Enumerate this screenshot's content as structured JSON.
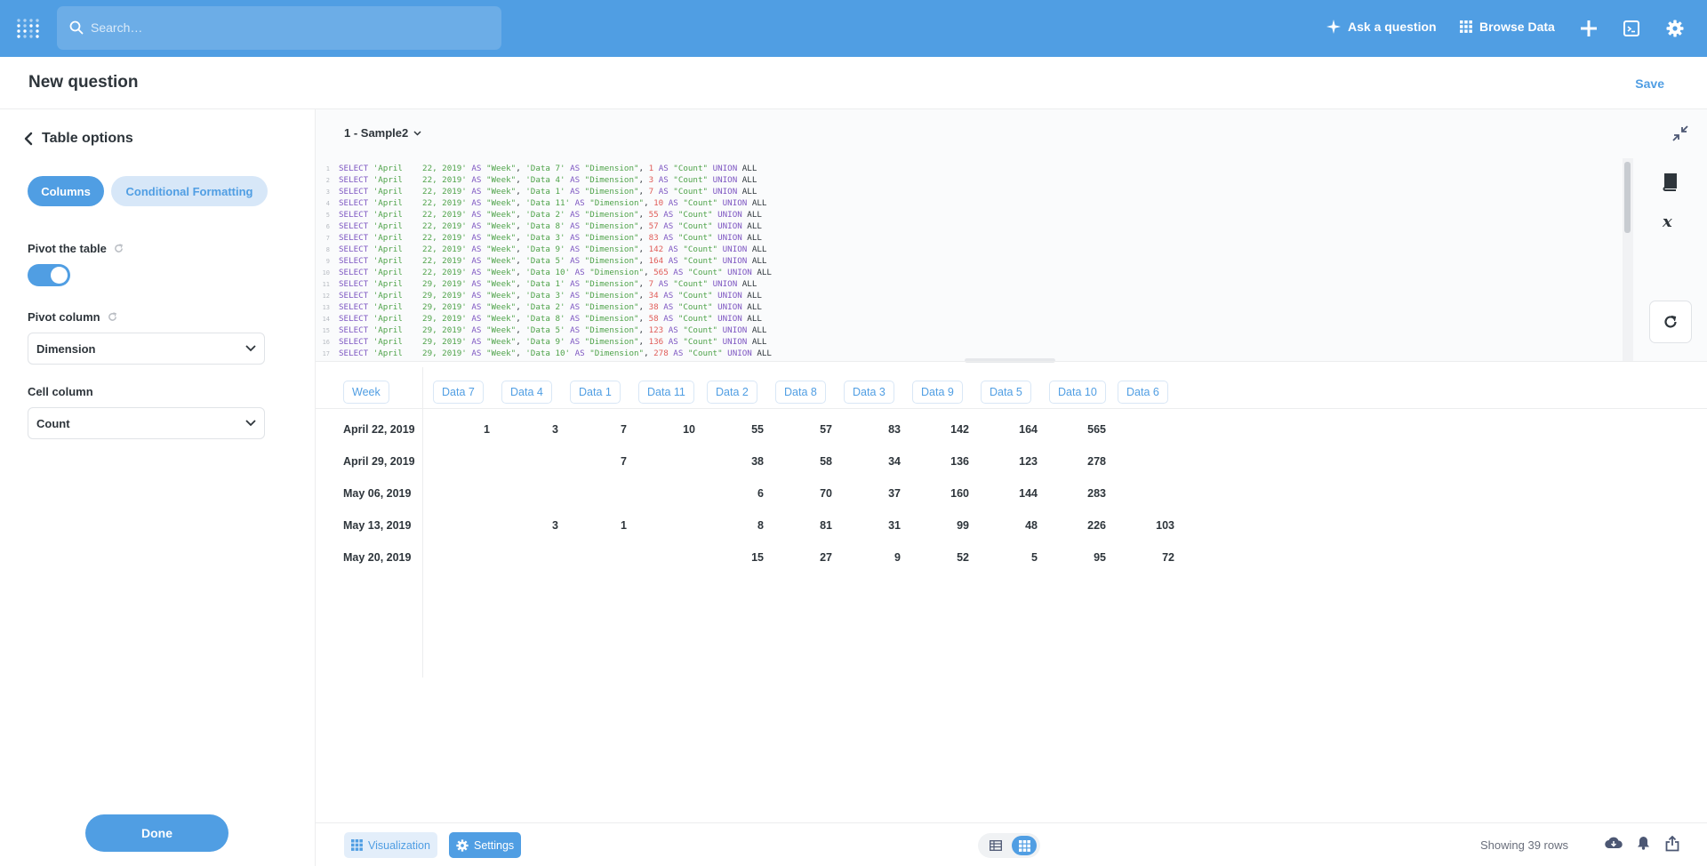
{
  "nav": {
    "search_placeholder": "Search…",
    "ask_question": "Ask a question",
    "browse_data": "Browse Data"
  },
  "header": {
    "title": "New question",
    "save": "Save"
  },
  "sidebar": {
    "back_label": "Table options",
    "tabs": {
      "columns": "Columns",
      "conditional": "Conditional Formatting"
    },
    "pivot_label": "Pivot the table",
    "pivot_on": true,
    "pivot_column_label": "Pivot column",
    "pivot_column_value": "Dimension",
    "cell_column_label": "Cell column",
    "cell_column_value": "Count",
    "done": "Done"
  },
  "editor": {
    "database": "1 - Sample2",
    "lines": [
      {
        "n": "1",
        "date": "'April    22, 2019'",
        "dim": "'Data 7'",
        "count": "1"
      },
      {
        "n": "2",
        "date": "'April    22, 2019'",
        "dim": "'Data 4'",
        "count": "3"
      },
      {
        "n": "3",
        "date": "'April    22, 2019'",
        "dim": "'Data 1'",
        "count": "7"
      },
      {
        "n": "4",
        "date": "'April    22, 2019'",
        "dim": "'Data 11'",
        "count": "10"
      },
      {
        "n": "5",
        "date": "'April    22, 2019'",
        "dim": "'Data 2'",
        "count": "55"
      },
      {
        "n": "6",
        "date": "'April    22, 2019'",
        "dim": "'Data 8'",
        "count": "57"
      },
      {
        "n": "7",
        "date": "'April    22, 2019'",
        "dim": "'Data 3'",
        "count": "83"
      },
      {
        "n": "8",
        "date": "'April    22, 2019'",
        "dim": "'Data 9'",
        "count": "142"
      },
      {
        "n": "9",
        "date": "'April    22, 2019'",
        "dim": "'Data 5'",
        "count": "164"
      },
      {
        "n": "10",
        "date": "'April    22, 2019'",
        "dim": "'Data 10'",
        "count": "565"
      },
      {
        "n": "11",
        "date": "'April    29, 2019'",
        "dim": "'Data 1'",
        "count": "7"
      },
      {
        "n": "12",
        "date": "'April    29, 2019'",
        "dim": "'Data 3'",
        "count": "34"
      },
      {
        "n": "13",
        "date": "'April    29, 2019'",
        "dim": "'Data 2'",
        "count": "38"
      },
      {
        "n": "14",
        "date": "'April    29, 2019'",
        "dim": "'Data 8'",
        "count": "58"
      },
      {
        "n": "15",
        "date": "'April    29, 2019'",
        "dim": "'Data 5'",
        "count": "123"
      },
      {
        "n": "16",
        "date": "'April    29, 2019'",
        "dim": "'Data 9'",
        "count": "136"
      },
      {
        "n": "17",
        "date": "'April    29, 2019'",
        "dim": "'Data 10'",
        "count": "278"
      }
    ]
  },
  "table": {
    "row_header": "Week",
    "columns": [
      "Data 7",
      "Data 4",
      "Data 1",
      "Data 11",
      "Data 2",
      "Data 8",
      "Data 3",
      "Data 9",
      "Data 5",
      "Data 10",
      "Data 6"
    ],
    "rows": [
      {
        "week": "April 22, 2019",
        "values": [
          "1",
          "3",
          "7",
          "10",
          "55",
          "57",
          "83",
          "142",
          "164",
          "565",
          ""
        ]
      },
      {
        "week": "April 29, 2019",
        "values": [
          "",
          "",
          "7",
          "",
          "38",
          "58",
          "34",
          "136",
          "123",
          "278",
          ""
        ]
      },
      {
        "week": "May 06, 2019",
        "values": [
          "",
          "",
          "",
          "",
          "6",
          "70",
          "37",
          "160",
          "144",
          "283",
          ""
        ]
      },
      {
        "week": "May 13, 2019",
        "values": [
          "",
          "3",
          "1",
          "",
          "8",
          "81",
          "31",
          "99",
          "48",
          "226",
          "103"
        ]
      },
      {
        "week": "May 20, 2019",
        "values": [
          "",
          "",
          "",
          "",
          "15",
          "27",
          "9",
          "52",
          "5",
          "95",
          "72"
        ]
      }
    ]
  },
  "footer": {
    "visualization": "Visualization",
    "settings": "Settings",
    "rows_count": "Showing 39 rows"
  },
  "colors": {
    "brand": "#509ee3",
    "text": "#2e353b"
  }
}
